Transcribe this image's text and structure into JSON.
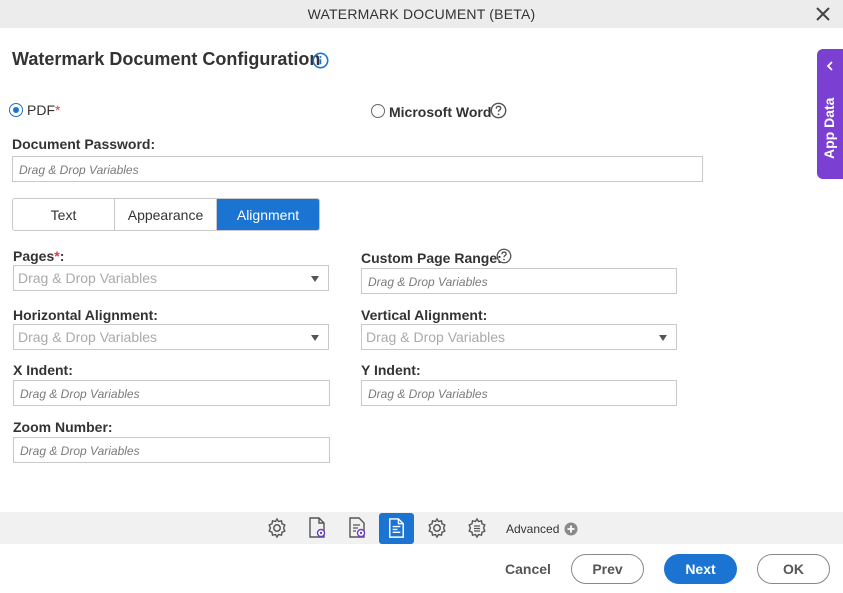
{
  "window": {
    "title": "WATERMARK DOCUMENT (BETA)"
  },
  "page": {
    "heading": "Watermark Document Configuration"
  },
  "format": {
    "pdf_label": "PDF",
    "required_mark": "*",
    "word_label": "Microsoft Word",
    "selected": "PDF"
  },
  "password": {
    "label": "Document Password:",
    "placeholder": "Drag & Drop Variables"
  },
  "tabs": [
    {
      "label": "Text"
    },
    {
      "label": "Appearance"
    },
    {
      "label": "Alignment"
    }
  ],
  "form": {
    "pages_label": "Pages",
    "pages_value": "Drag & Drop Variables",
    "custom_range_label": "Custom Page Range:",
    "custom_range_placeholder": "Drag & Drop Variables",
    "halign_label": "Horizontal Alignment:",
    "halign_value": "Drag & Drop Variables",
    "valign_label": "Vertical Alignment:",
    "valign_value": "Drag & Drop Variables",
    "xindent_label": "X Indent:",
    "xindent_placeholder": "Drag & Drop Variables",
    "yindent_label": "Y Indent:",
    "yindent_placeholder": "Drag & Drop Variables",
    "zoom_label": "Zoom Number:",
    "zoom_placeholder": "Drag & Drop Variables"
  },
  "side_panel": {
    "label": "App Data"
  },
  "toolbar": {
    "icons": [
      "settings-icon",
      "document-settings-icon",
      "document-config-icon",
      "document-alignment-icon",
      "gear-icon",
      "list-settings-icon"
    ],
    "advanced_label": "Advanced"
  },
  "footer": {
    "cancel": "Cancel",
    "prev": "Prev",
    "next": "Next",
    "ok": "OK"
  },
  "colors": {
    "accent": "#1b74d2",
    "side_panel": "#7b3fd1",
    "required": "#e0383e"
  }
}
